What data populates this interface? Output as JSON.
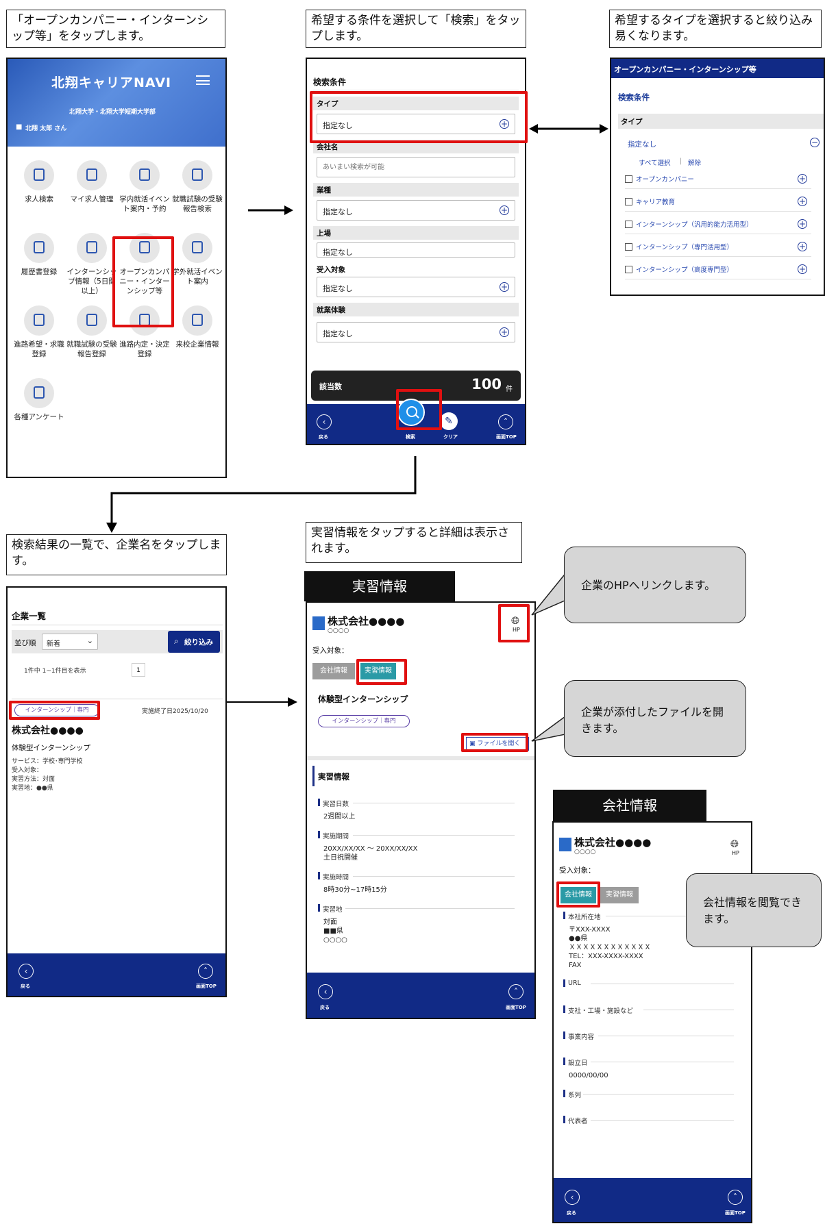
{
  "captions": {
    "c1": "「オープンカンパニー・インターンシップ等」をタップします。",
    "c2": "希望する条件を選択して「検索」をタップします。",
    "c3": "希望するタイプを選択すると絞り込み易くなります。",
    "c4": "検索結果の一覧で、企業名をタップします。",
    "c5": "実習情報をタップすると詳細は表示されます。"
  },
  "bubbles": {
    "hp": "企業のHPへリンクします。",
    "file": "企業が添付したファイルを開きます。",
    "company": "会社情報を閲覧できます。"
  },
  "colors": {
    "navy": "#112a86",
    "red": "#e01010",
    "teal": "#2a9aa6",
    "bubble": "#d6d6d6"
  },
  "home": {
    "title": "北翔キャリアNAVI",
    "subtitle": "北翔大学・北翔大学短期大学部",
    "user": "北翔 太郎 さん",
    "tiles": [
      {
        "label": "求人検索",
        "icon": "search-list-icon"
      },
      {
        "label": "マイ求人管理",
        "icon": "bookmark-search-icon"
      },
      {
        "label": "学内就活イベント案内・予約",
        "icon": "people-icon"
      },
      {
        "label": "就職試験の受験報告検索",
        "icon": "report-search-icon"
      },
      {
        "label": "履歴書登録",
        "icon": "document-icon"
      },
      {
        "label": "インターンシップ情報（5日間以上）",
        "icon": "intern-icon"
      },
      {
        "label": "オープンカンパニー・インターンシップ等",
        "icon": "badge-icon"
      },
      {
        "label": "学外就活イベント案内",
        "icon": "edit-icon"
      },
      {
        "label": "進路希望・求職登録",
        "icon": "form-icon"
      },
      {
        "label": "就職試験の受験報告登録",
        "icon": "report-icon"
      },
      {
        "label": "進路内定・決定登録",
        "icon": "stamp-icon"
      },
      {
        "label": "来校企業情報",
        "icon": "building-icon"
      },
      {
        "label": "各種アンケート",
        "icon": "survey-icon"
      }
    ]
  },
  "search": {
    "heading": "検索条件",
    "type_label": "タイプ",
    "type_value": "指定なし",
    "company_label": "会社名",
    "company_placeholder": "あいまい検索が可能",
    "industry_label": "業種",
    "industry_value": "指定なし",
    "listed_label": "上場",
    "listed_value": "指定なし",
    "target_label": "受入対象",
    "target_value": "指定なし",
    "exp_label": "就業体験",
    "exp_value": "指定なし",
    "count_label": "該当数",
    "count_value": "100",
    "count_unit": "件",
    "nav": {
      "back": "戻る",
      "search": "検索",
      "clear": "クリア",
      "top": "画面TOP"
    }
  },
  "typepanel": {
    "title": "オープンカンパニー・インターンシップ等",
    "heading": "検索条件",
    "type_label": "タイプ",
    "value": "指定なし",
    "select_all": "すべて選択",
    "unselect": "解除",
    "options": [
      "オープンカンパニー",
      "キャリア教育",
      "インターンシップ（汎用的能力活用型）",
      "インターンシップ（専門活用型）",
      "インターンシップ（高度専門型）"
    ]
  },
  "list": {
    "heading": "企業一覧",
    "sort_label": "並び順",
    "sort_value": "新着",
    "filter_button": "絞り込み",
    "paging": "1件中 1~1件目を表示",
    "page": "1",
    "tag": "インターンシップ｜専門",
    "end_date": "実施終了日2025/10/20",
    "company": "株式会社●●●●",
    "program": "体験型インターンシップ",
    "lines": [
      "サービス：学校･専門学校",
      "受入対象：",
      "実習方法：対面",
      "実習地：●●県"
    ],
    "nav": {
      "back": "戻る",
      "top": "画面TOP"
    }
  },
  "detail": {
    "band": "実習情報",
    "company": "株式会社●●●●",
    "kana": "○○○○",
    "hp": "HP",
    "target": "受入対象：",
    "tab_company": "会社情報",
    "tab_practice": "実習情報",
    "program": "体験型インターンシップ",
    "tag": "インターンシップ｜専門",
    "file_button": "ファイルを開く",
    "section": "実習情報",
    "fields": [
      {
        "label": "実習日数",
        "value": "2週間以上"
      },
      {
        "label": "実施期間",
        "value": "20XX/XX/XX ～ 20XX/XX/XX\n土日祝開催"
      },
      {
        "label": "実施時間",
        "value": "8時30分~17時15分"
      },
      {
        "label": "実習地",
        "value": "対面\n■■県\n○○○○"
      }
    ],
    "nav": {
      "back": "戻る",
      "top": "画面TOP"
    }
  },
  "company": {
    "band": "会社情報",
    "company": "株式会社●●●●",
    "kana": "○○○○",
    "hp": "HP",
    "target": "受入対象：",
    "tab_company": "会社情報",
    "tab_practice": "実習情報",
    "fields": [
      {
        "label": "本社所在地",
        "value": "〒XXX-XXXX\n●●県\nＸＸＸＸＸＸＸＸＸＸＸＸ\nTEL：XXX-XXXX-XXXX\nFAX"
      },
      {
        "label": "URL",
        "value": ""
      },
      {
        "label": "支社・工場・施設など",
        "value": ""
      },
      {
        "label": "事業内容",
        "value": ""
      },
      {
        "label": "設立日",
        "value": "0000/00/00"
      },
      {
        "label": "系列",
        "value": ""
      },
      {
        "label": "代表者",
        "value": ""
      }
    ],
    "nav": {
      "back": "戻る",
      "top": "画面TOP"
    }
  }
}
